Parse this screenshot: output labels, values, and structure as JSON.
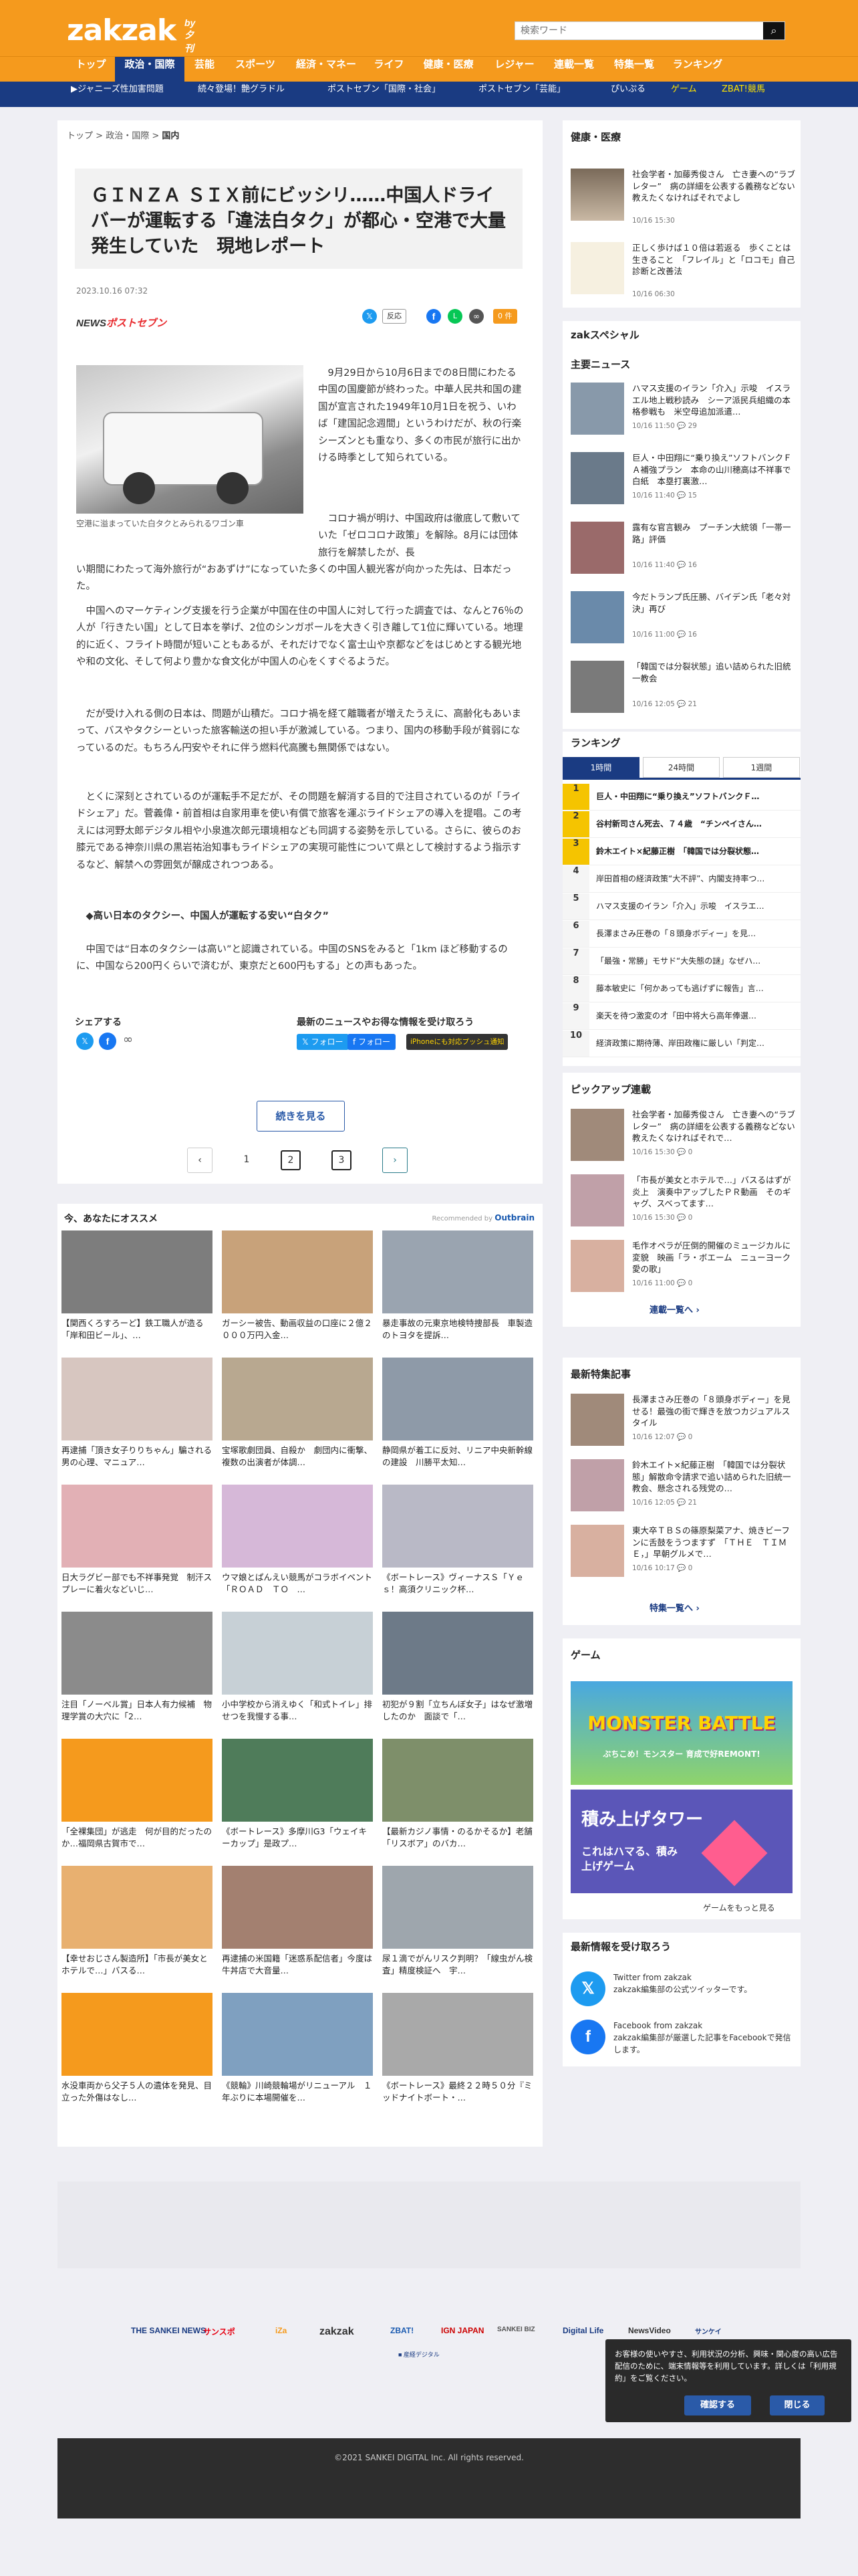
{
  "header": {
    "logo": "zakzak",
    "logo_sub": "by夕刊フジ",
    "search_placeholder": "検索ワード",
    "search_icon": "search-icon"
  },
  "gnav": [
    "トップ",
    "政治・国際",
    "芸能",
    "スポーツ",
    "経済・マネー",
    "ライフ",
    "健康・医療",
    "レジャー",
    "連載一覧",
    "特集一覧",
    "ランキング"
  ],
  "subnav": [
    "▶ジャニーズ性加害問題",
    "続々登場！艶グラドル",
    "ポストセブン「国際・社会」",
    "ポストセブン「芸能」",
    "ぴいぷる",
    "ゲーム",
    "ZBAT!競馬"
  ],
  "breadcrumb": {
    "home": "トップ",
    "sep": ">",
    "section": "政治・国際",
    "current": "国内"
  },
  "article": {
    "title": "ＧＩＮＺＡ ＳＩＸ前にビッシリ……中国人ドライバーが運転する「違法白タク」が都心・空港で大量発生していた　現地レポート",
    "date": "2023.10.16 07:32",
    "source_a": "NEWS",
    "source_b": "ポストセブン",
    "share_react": "反応",
    "share_comment": "0 件",
    "caption": "空港に溢まっていた白タクとみられるワゴン車",
    "p1": "9月29日から10月6日までの8日間にわたる中国の国慶節が終わった。中華人民共和国の建国が宣言された1949年10月1日を祝う、いわば「建国記念週間」というわけだが、秋の行楽シーズンとも重なり、多くの市民が旅行に出かける時季として知られている。",
    "p2": "コロナ禍が明け、中国政府は徹底して敷いていた「ゼロコロナ政策」を解除。8月には団体旅行を解禁したが、長い期間にわたって海外旅行が“おあずけ”になっていた多くの中国人観光客が向かった先は、日本だった。",
    "p3": "中国へのマーケティング支援を行う企業が中国在住の中国人に対して行った調査では、なんと76％の人が「行きたい国」として日本を挙げ、2位のシンガポールを大きく引き離して1位に輝いている。地理的に近く、フライト時間が短いこともあるが、それだけでなく富士山や京都などをはじめとする観光地や和の文化、そして何より豊かな食文化が中国人の心をくすぐるようだ。",
    "p4": "だが受け入れる側の日本は、問題が山積だ。コロナ禍を経て離職者が増えたうえに、高齢化もあいまって、バスやタクシーといった旅客輸送の担い手が激減している。つまり、国内の移動手段が貧弱になっているのだ。もちろん円安やそれに伴う燃料代高騰も無関係ではない。",
    "p5": "とくに深刻とされているのが運転手不足だが、その問題を解消する目的で注目されているのが「ライドシェア」だ。菅義偉・前首相は自家用車を使い有償で旅客を運ぶライドシェアの導入を提唱。この考えには河野太郎デジタル相や小泉進次郎元環境相なども同調する姿勢を示している。さらに、彼らのお膝元である神奈川県の黒岩祐治知事もライドシェアの実現可能性について県として検討するよう指示するなど、解禁への雰囲気が醸成されつつある。",
    "heading": "◆高い日本のタクシー、中国人が運転する安い“白タク”",
    "p6": "中国では“日本のタクシーは高い”と認識されている。中国のSNSをみると「1km ほど移動するのに、中国なら200円くらいで済むが、東京だと600円もする」との声もあった。"
  },
  "follow": {
    "share_label": "シェアする",
    "latest_label": "最新のニュースやお得な情報を受け取ろう",
    "btn_x": "フォロー",
    "btn_fb": "フォロー",
    "btn_push": "iPhoneにも対応プッシュ通知"
  },
  "more_button": "続きを見る",
  "pagination": {
    "prev": "‹",
    "p1": "1",
    "p2": "2",
    "p3": "3",
    "next": "›"
  },
  "recommend": {
    "heading": "今、あなたにオススメ",
    "by": "Recommended by",
    "brand": "Outbrain",
    "items": [
      "【関西くろすろーど】鉄工職人が造る「岸和田ビール」、…",
      "ガーシー被告、動画収益の口座に２億２０００万円入金…",
      "暴走事故の元東京地検特捜部長　車製造のトヨタを提訴…",
      "再逮捕「頂き女子りりちゃん」騙される男の心理、マニュア…",
      "宝塚歌劇団員、自殺か　劇団内に衝撃、複数の出演者が体調…",
      "静岡県が着工に反対、リニア中央新幹線の建設　川勝平太知…",
      "日大ラグビー部でも不祥事発覚　制汗スプレーに着火などいじ…",
      "ウマ娘とぱんえい競馬がコラボイベント「ＲＯＡＤ　ＴＯ　…",
      "《ボートレース》ヴィーナスＳ「Ｙｅｓ！高須クリニック杯…",
      "注目「ノーベル賞」日本人有力候補　物理学賞の大穴に「2…",
      "小中学校から消えゆく「和式トイレ」排せつを我慢する事…",
      "初犯が９割「立ちんぼ女子」はなぜ激増したのか　面談で「…",
      "「全裸集団」が逃走　何が目的だったのか…福岡県古賀市で…",
      "《ボートレース》多摩川G3「ウェイキーカップ」是政プ…",
      "【最新カジノ事情・のるかそるか】老舗「リスボア」のバカ…",
      "【幸せおじさん製造所】「市長が美女とホテルで…」バスる…",
      "再逮捕の米国籍「迷惑系配信者」今度は牛丼店で大音量…",
      "尿１滴でがんリスク判明？「線虫がん検査」精度検証へ　宇…",
      "水没車両から父子５人の遺体を発見、目立った外傷はなし…",
      "《競輪》川崎競輪場がリニューアル　１年ぶりに本場開催を…",
      "《ボートレース》最終２２時５０分『ミッドナイトボート・…"
    ]
  },
  "side_health": {
    "heading": "健康・医療",
    "items": [
      {
        "text": "社会学者・加藤秀俊さん　亡き妻への“ラブレター”　病の詳細を公表する義務などない　教えたくなければそれでよし",
        "time": "10/16 15:30"
      },
      {
        "text": "正しく歩けば１０倍は若返る　歩くことは生きること　「フレイル」と「ロコモ」自己診断と改善法",
        "time": "10/16 06:30"
      }
    ]
  },
  "side_special": {
    "heading": "zakスペシャル"
  },
  "side_main": {
    "heading": "主要ニュース",
    "items": [
      {
        "text": "ハマス支援のイラン「介入」示唆　イスラエル地上戦秒読み　シーア派民兵組織の本格参戦も　米空母追加派遣…",
        "time": "10/16 11:50",
        "comments": "29"
      },
      {
        "text": "巨人・中田翔に“乗り換え”ソフトバンクＦＡ補強プラン　本命の山川穂高は不祥事で白紙　本塁打裏激…",
        "time": "10/16 11:40",
        "comments": "15"
      },
      {
        "text": "露有な官言観み　プーチン大統領「一帯一路」評価",
        "time": "10/16 11:40",
        "comments": "16"
      },
      {
        "text": "今だトランプ氏圧勝、バイデン氏「老々対決」再び",
        "time": "10/16 11:00",
        "comments": "16"
      },
      {
        "text": "「韓国では分裂状態」追い詰められた旧統一教会",
        "time": "10/16 12:05",
        "comments": "21"
      }
    ]
  },
  "ranking": {
    "heading": "ランキング",
    "tabs": [
      "1時間",
      "24時間",
      "1週間"
    ],
    "items": [
      "巨人・中田翔に“乗り換え”ソフトバンクＦ…",
      "谷村新司さん死去、７４歳　“チンペイさん…",
      "鈴木エイト×紀藤正樹　「韓国では分裂状態…",
      "岸田首相の経済政策“大不評”、内閣支持率つ…",
      "ハマス支援のイラン「介入」示唆　イスラエ…",
      "長澤まさみ圧巻の「８頭身ボディー」を見…",
      "「最強・常勝」モサド“大失態の謎」なぜハ…",
      "藤本敏史に「何かあっても逃げずに報告」言…",
      "楽天を待つ激変の才「田中将大ら高年俸選…",
      "経済政策に期待薄、岸田政権に厳しい「判定…"
    ]
  },
  "pickup": {
    "heading": "ピックアップ連載",
    "items": [
      {
        "text": "社会学者・加藤秀俊さん　亡き妻への“ラブレター”　病の詳細を公表する義務などない　教えたくなければそれで…",
        "time": "10/16 15:30",
        "comments": "0"
      },
      {
        "text": "「市長が美女とホテルで…」バスるはずが炎上　演奏中アップしたＰＲ動画　そのギャグ、スベってます…",
        "time": "10/16 15:30",
        "comments": "0"
      },
      {
        "text": "毛作オペラが圧倒的開催のミュージカルに変貌　映画「ラ・ボエーム　ニューヨーク愛の歌」",
        "time": "10/16 11:00",
        "comments": "0"
      }
    ],
    "cta": "連載一覧へ ›"
  },
  "feature": {
    "heading": "最新特集記事",
    "items": [
      {
        "text": "長澤まさみ圧巻の「８頭身ボディー」を見せる！最強の街で輝きを放つカジュアルスタイル",
        "time": "10/16 12:07",
        "comments": "0"
      },
      {
        "text": "鈴木エイト×紀藤正樹　「韓国では分裂状態」解散命令請求で追い詰められた旧統一教会、懸念される残党の…",
        "time": "10/16 12:05",
        "comments": "21"
      },
      {
        "text": "東大卒ＴＢＳの篠原梨菜アナ、焼きビーフンに舌鼓をうつますず　「ＴＨＥ　ＴＩＭＥ，」早朝グルメで…",
        "time": "10/16 10:17",
        "comments": "0"
      }
    ],
    "cta": "特集一覧へ ›"
  },
  "games": {
    "heading": "ゲーム",
    "g1": "MONSTER BATTLE",
    "g1sub": "ぶちこめ！モンスター 育成で好REMONT!",
    "g2": "積み上げタワー",
    "g2sub": "これはハマる、積み上げゲーム",
    "cta": "ゲームをもっと見る"
  },
  "sns": {
    "heading": "最新情報を受け取ろう",
    "tw": "Twitter from zakzak",
    "tw_desc": "zakzak編集部の公式ツイッターです。",
    "fb": "Facebook from zakzak",
    "fb_desc": "zakzak編集部が厳選した記事をFacebookで発信します。"
  },
  "footer_logos": [
    "THE SANKEI NEWS",
    "サンスポ",
    "iZa",
    "zakzak",
    "ZBAT!",
    "IGN JAPAN",
    "SANKEI BIZ",
    "Digital Life",
    "NewsVideo",
    "サンケイ"
  ],
  "footer_link": "■ 産経デジタル",
  "copyright": "©2021 SANKEI DIGITAL Inc. All rights reserved.",
  "cookie": {
    "text": "お客様の使いやすさ、利用状況の分析、興味・関心度の高い広告配信のために、端末情報等を利用しています。詳しくは「利用規約」をご覧ください。",
    "accept": "確認する",
    "close": "閉じる"
  }
}
